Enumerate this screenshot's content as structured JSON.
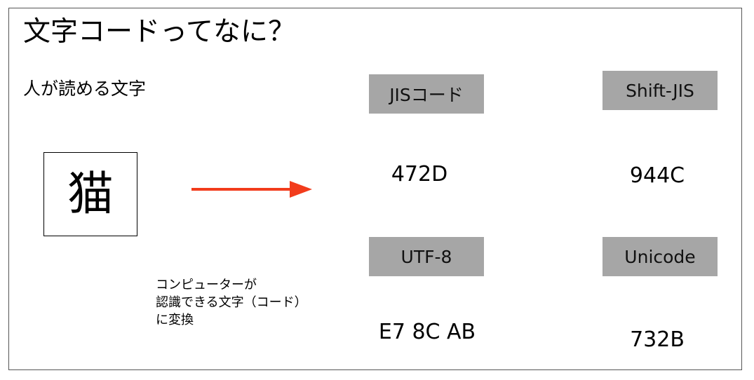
{
  "title": "文字コードってなに？",
  "subtitle": "人が読める文字",
  "character": "猫",
  "note": {
    "line1": "コンピューターが",
    "line2": "認識できる文字（コード）",
    "line3": "に変換"
  },
  "arrow": {
    "color": "#f23c1c"
  },
  "encodings": {
    "jis": {
      "label": "JISコード",
      "code": "472D"
    },
    "sjis": {
      "label": "Shift-JIS",
      "code": "944C"
    },
    "utf8": {
      "label": "UTF-8",
      "code": "E7 8C AB"
    },
    "unicode": {
      "label": "Unicode",
      "code": "732B"
    }
  },
  "colors": {
    "label_box": "#a6a6a6",
    "border": "#555555"
  }
}
